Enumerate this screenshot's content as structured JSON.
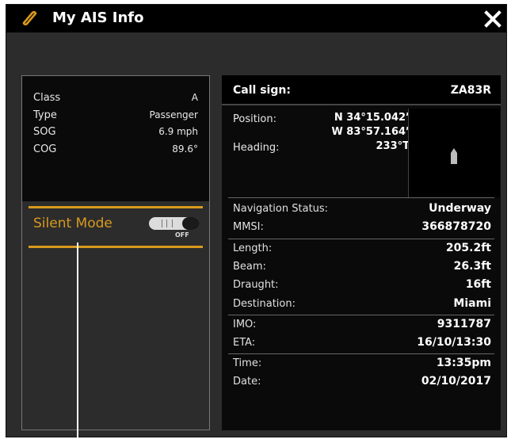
{
  "window": {
    "title": "My AIS Info",
    "title_icon": "tag-icon",
    "close_icon": "close-icon"
  },
  "vessel_stats": [
    {
      "label": "Class",
      "value": "A"
    },
    {
      "label": "Type",
      "value": "Passenger"
    },
    {
      "label": "SOG",
      "value": "6.9 mph"
    },
    {
      "label": "COG",
      "value": "89.6°"
    }
  ],
  "silent_mode": {
    "label": "Silent Mode",
    "state": "OFF"
  },
  "details": {
    "call_sign_label": "Call sign:",
    "call_sign_value": "ZA83R",
    "position_label": "Position:",
    "position_lat": "N 34°15.042’",
    "position_lon": "W 83°57.164’",
    "heading_label": "Heading:",
    "heading_value": "233°T",
    "rows": [
      {
        "label": "Navigation Status:",
        "value": "Underway"
      },
      {
        "label": "MMSI:",
        "value": "366878720"
      },
      {
        "label": "Length:",
        "value": "205.2ft"
      },
      {
        "label": "Beam:",
        "value": "26.3ft"
      },
      {
        "label": "Draught:",
        "value": "16ft"
      },
      {
        "label": "Destination:",
        "value": "Miami"
      },
      {
        "label": "IMO:",
        "value": "9311787"
      },
      {
        "label": "ETA:",
        "value": "16/10/13:30"
      },
      {
        "label": "Time:",
        "value": "13:35pm"
      },
      {
        "label": "Date:",
        "value": "02/10/2017"
      }
    ]
  },
  "colors": {
    "accent": "#d99a1c",
    "frame": "#2c2c2c",
    "panel": "#0a0a0a"
  }
}
